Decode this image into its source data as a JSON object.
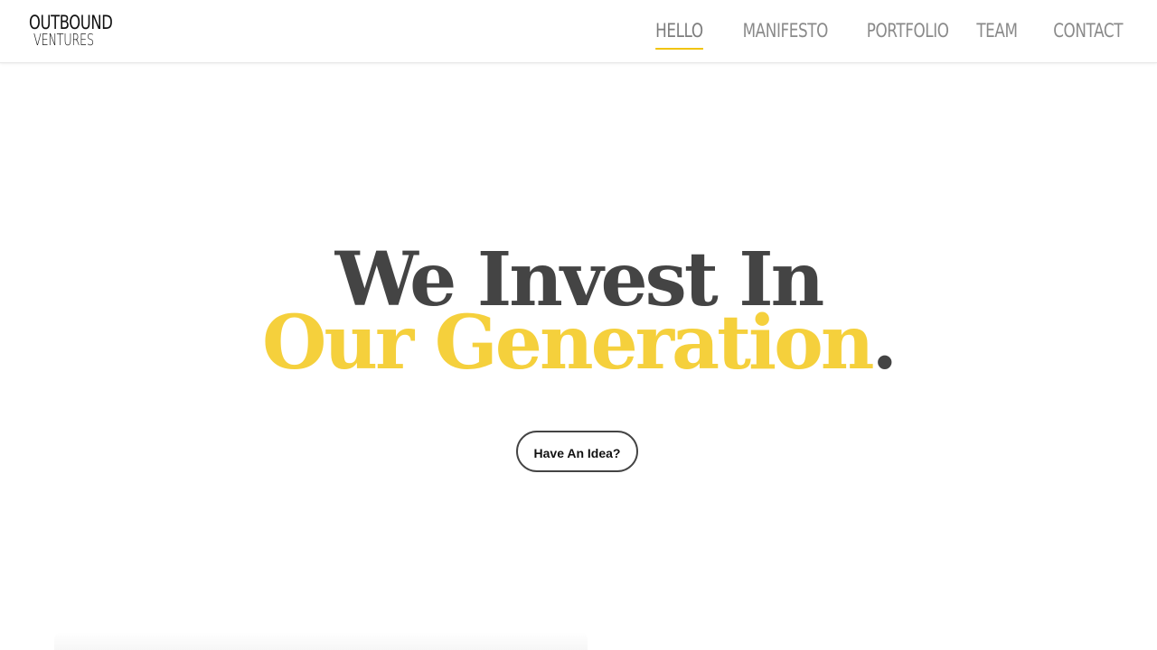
{
  "logo": {
    "line1": "OUTBOUND",
    "line2": "VENTURES"
  },
  "nav": {
    "items": [
      {
        "label": "HELLO",
        "active": true
      },
      {
        "label": "MANIFESTO",
        "active": false
      },
      {
        "label": "PORTFOLIO",
        "active": false
      },
      {
        "label": "TEAM",
        "active": false
      },
      {
        "label": "CONTACT",
        "active": false
      }
    ]
  },
  "hero": {
    "headline_line1": "We Invest In",
    "headline_highlight": "Our Generation",
    "headline_period": ".",
    "cta_label": "Have An Idea?"
  },
  "colors": {
    "accent": "#f5d03c",
    "active_underline": "#f1c40f",
    "text_dark": "#444444",
    "nav_text": "#8a8a8a"
  }
}
